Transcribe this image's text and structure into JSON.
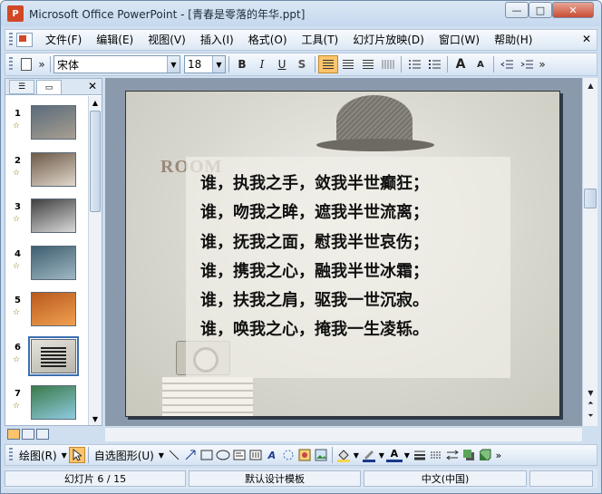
{
  "window": {
    "app_icon_letter": "P",
    "title": "Microsoft Office PowerPoint - [青春是零落的年华.ppt]",
    "minimize": "—",
    "maximize": "□",
    "close": "✕"
  },
  "menubar": {
    "items": [
      "文件(F)",
      "编辑(E)",
      "视图(V)",
      "插入(I)",
      "格式(O)",
      "工具(T)",
      "幻灯片放映(D)",
      "窗口(W)",
      "帮助(H)"
    ],
    "close_glyph": "✕"
  },
  "toolbar": {
    "font_name": "宋体",
    "font_size": "18",
    "bold": "B",
    "italic": "I",
    "underline": "U",
    "shadow": "S",
    "grow_font": "A",
    "shrink_font": "A",
    "align_left_active": true
  },
  "left_pane": {
    "tab_outline": "☰",
    "tab_slides": "▭",
    "close_glyph": "✕",
    "slides": [
      {
        "num": "1",
        "colors": [
          "#5a6b7a",
          "#a89f92"
        ]
      },
      {
        "num": "2",
        "colors": [
          "#6d5a48",
          "#e0d8cc"
        ]
      },
      {
        "num": "3",
        "colors": [
          "#404040",
          "#d9d9d9"
        ]
      },
      {
        "num": "4",
        "colors": [
          "#3e5e6e",
          "#9fb8c4"
        ]
      },
      {
        "num": "5",
        "colors": [
          "#b85a1e",
          "#f0a050"
        ]
      },
      {
        "num": "6",
        "colors": [
          "#e4e2da",
          "#b8b6ad"
        ],
        "selected": true
      },
      {
        "num": "7",
        "colors": [
          "#3b7a4a",
          "#8ecbe0"
        ]
      }
    ],
    "star_glyph": "☆"
  },
  "slide": {
    "decor_text": "ROOM",
    "poem": [
      "谁，执我之手，敛我半世癫狂；",
      "谁，吻我之眸，遮我半世流离；",
      "谁，抚我之面，慰我半世哀伤；",
      "谁，携我之心，融我半世冰霜；",
      "谁，扶我之肩，驱我一世沉寂。",
      "谁，唤我之心，掩我一生凌轹。"
    ]
  },
  "drawbar": {
    "draw_label": "绘图(R)",
    "autoshapes_label": "自选图形(U)"
  },
  "status": {
    "slide_info": "幻灯片 6 / 15",
    "template": "默认设计模板",
    "language": "中文(中国)"
  }
}
